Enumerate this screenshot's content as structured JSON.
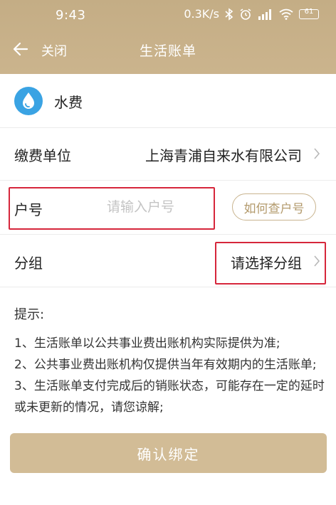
{
  "status_bar": {
    "time": "9:43",
    "speed": "0.3K/s",
    "battery": "61",
    "icons": [
      "bluetooth-icon",
      "alarm-icon",
      "signal-icon",
      "wifi-icon",
      "battery-icon"
    ]
  },
  "nav": {
    "close_label": "关闭",
    "title": "生活账单"
  },
  "bill": {
    "icon": "water-drop-icon",
    "name": "水费"
  },
  "form": {
    "unit_label": "缴费单位",
    "unit_value": "上海青浦自来水有限公司",
    "account_label": "户号",
    "account_placeholder": "请输入户号",
    "account_value": "",
    "howto_label": "如何查户号",
    "group_label": "分组",
    "group_value": "请选择分组"
  },
  "tips": {
    "title": "提示:",
    "items": [
      "1、生活账单以公共事业费出账机构实际提供为准;",
      "2、公共事业费出账机构仅提供当年有效期内的生活账单;",
      "3、生活账单支付完成后的销账状态，可能存在一定的延时"
    ],
    "item3_cont": "或未更新的情况，请您谅解;"
  },
  "confirm_label": "确认绑定",
  "colors": {
    "header": "#c8b089",
    "accent": "#b39a6c",
    "button": "#d2bc96",
    "highlight": "#d6263b",
    "water": "#3aa3e3"
  }
}
